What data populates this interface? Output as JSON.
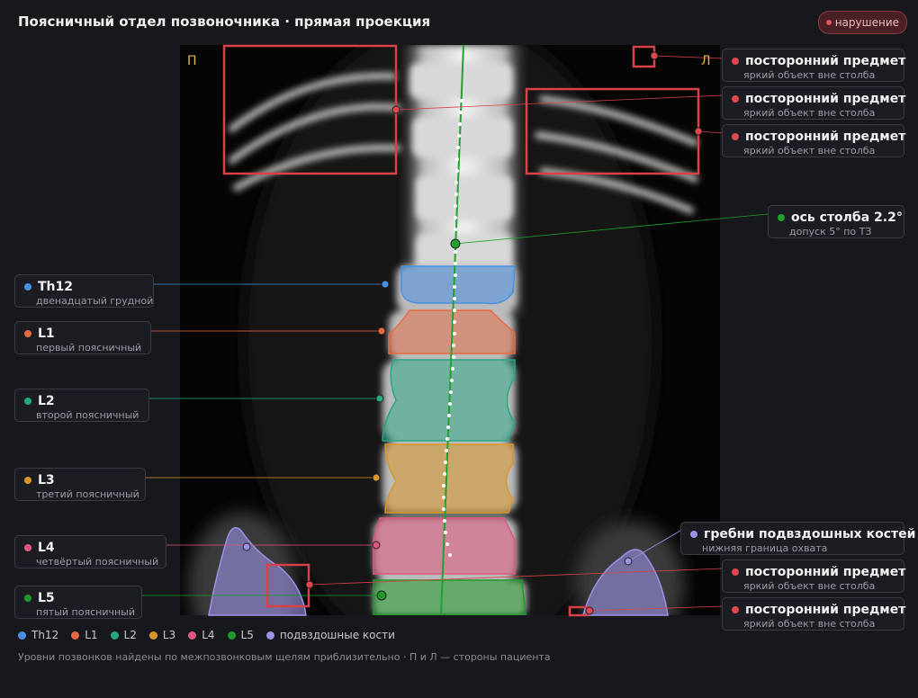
{
  "header": {
    "title": "Поясничный отдел позвоночника · прямая проекция",
    "status_badge": "нарушение",
    "status_color": "#e0565f"
  },
  "image": {
    "side_right_marker": "П",
    "side_left_marker": "Л"
  },
  "callouts": {
    "foreign_1": {
      "title": "посторонний предмет",
      "subtitle": "яркий объект вне столба",
      "color": "#e0474f"
    },
    "foreign_2": {
      "title": "посторонний предмет",
      "subtitle": "яркий объект вне столба",
      "color": "#e0474f"
    },
    "foreign_3": {
      "title": "посторонний предмет",
      "subtitle": "яркий объект вне столба",
      "color": "#e0474f"
    },
    "axis": {
      "title": "ось столба 2.2°",
      "subtitle": "допуск 5° по ТЗ",
      "color": "#1fa32c"
    },
    "th12": {
      "title": "Th12",
      "subtitle": "двенадцатый грудной",
      "color": "#4a90e2"
    },
    "l1": {
      "title": "L1",
      "subtitle": "первый поясничный",
      "color": "#e8693f"
    },
    "l2": {
      "title": "L2",
      "subtitle": "второй поясничный",
      "color": "#26a883"
    },
    "l3": {
      "title": "L3",
      "subtitle": "третий поясничный",
      "color": "#d9962a"
    },
    "l4": {
      "title": "L4",
      "subtitle": "четвёртый поясничный",
      "color": "#e0577f"
    },
    "l5": {
      "title": "L5",
      "subtitle": "пятый поясничный",
      "color": "#1f9a2a"
    },
    "iliac": {
      "title": "гребни подвздошных костей",
      "subtitle": "нижняя граница охвата",
      "color": "#9b93e6"
    },
    "foreign_4": {
      "title": "посторонний предмет",
      "subtitle": "яркий объект вне столба",
      "color": "#e0474f"
    },
    "foreign_5": {
      "title": "посторонний предмет",
      "subtitle": "яркий объект вне столба",
      "color": "#e0474f"
    }
  },
  "legend": {
    "items": [
      {
        "label": "Th12",
        "color": "#4a90e2"
      },
      {
        "label": "L1",
        "color": "#e8693f"
      },
      {
        "label": "L2",
        "color": "#26a883"
      },
      {
        "label": "L3",
        "color": "#d9962a"
      },
      {
        "label": "L4",
        "color": "#e0577f"
      },
      {
        "label": "L5",
        "color": "#1f9a2a"
      },
      {
        "label": "подвздошные кости",
        "color": "#9b93e6"
      }
    ]
  },
  "footnote": "Уровни позвонков найдены по межпозвонковым щелям приблизительно · П и Л — стороны пациента"
}
